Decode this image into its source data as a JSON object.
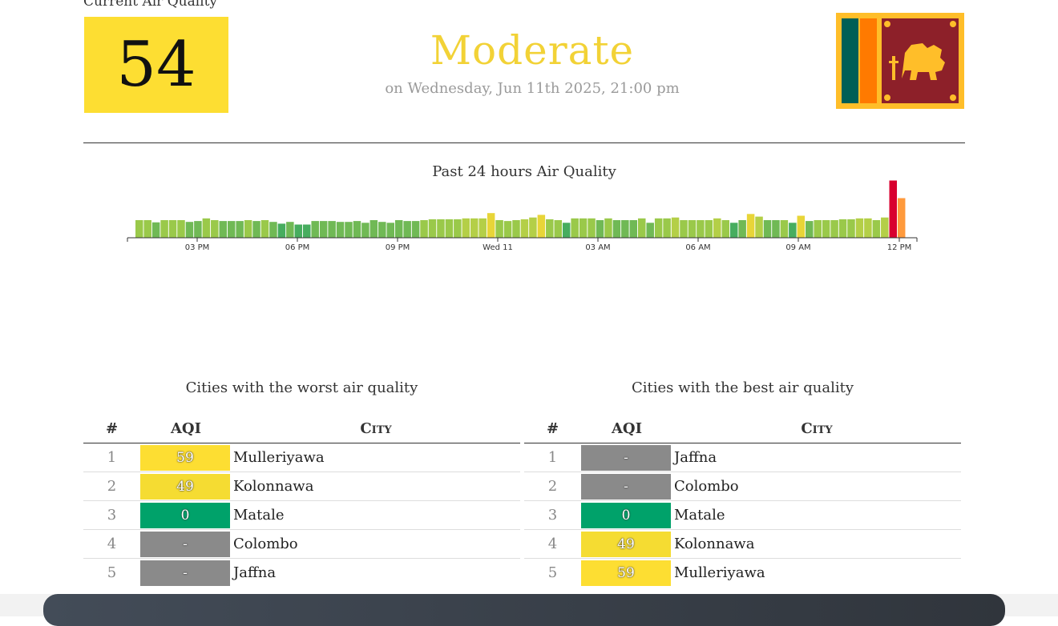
{
  "header": {
    "label": "Current Air Quality",
    "aqi_value": "54",
    "aqi_color": "#fdde32",
    "status": "Moderate",
    "status_color": "#f2d236",
    "date_text": "on Wednesday, Jun 11th 2025, 21:00 pm",
    "flag_icon": "sri-lanka-flag-icon"
  },
  "chart_data": {
    "type": "bar",
    "title": "Past 24 hours Air Quality",
    "tick_labels": [
      "03 PM",
      "06 PM",
      "09 PM",
      "Wed 11",
      "03 AM",
      "06 AM",
      "09 AM",
      "12 PM"
    ],
    "ylim": [
      0,
      120
    ],
    "values": [
      40,
      40,
      35,
      40,
      40,
      40,
      36,
      38,
      44,
      40,
      38,
      38,
      38,
      40,
      38,
      40,
      36,
      32,
      36,
      30,
      30,
      38,
      38,
      38,
      36,
      36,
      38,
      34,
      40,
      36,
      34,
      40,
      38,
      38,
      40,
      42,
      42,
      42,
      42,
      44,
      44,
      44,
      56,
      40,
      38,
      40,
      42,
      46,
      52,
      42,
      40,
      34,
      44,
      44,
      44,
      40,
      44,
      40,
      40,
      40,
      44,
      34,
      44,
      44,
      46,
      40,
      40,
      40,
      40,
      44,
      40,
      34,
      40,
      54,
      48,
      40,
      40,
      40,
      34,
      50,
      38,
      40,
      40,
      40,
      42,
      42,
      44,
      44,
      40,
      46,
      130,
      90
    ],
    "colors": [
      "#9ac94a",
      "#9ac94a",
      "#70b955",
      "#9ac94a",
      "#9ac94a",
      "#9ac94a",
      "#70b955",
      "#70b955",
      "#9ac94a",
      "#9ac94a",
      "#70b955",
      "#70b955",
      "#70b955",
      "#9ac94a",
      "#70b955",
      "#9ac94a",
      "#70b955",
      "#47ad5f",
      "#70b955",
      "#47ad5f",
      "#47ad5f",
      "#70b955",
      "#70b955",
      "#70b955",
      "#70b955",
      "#70b955",
      "#70b955",
      "#70b955",
      "#70b955",
      "#70b955",
      "#70b955",
      "#70b955",
      "#70b955",
      "#70b955",
      "#9ac94a",
      "#9ac94a",
      "#9ac94a",
      "#9ac94a",
      "#9ac94a",
      "#b4cf47",
      "#b4cf47",
      "#b4cf47",
      "#e8d538",
      "#9ac94a",
      "#9ac94a",
      "#9ac94a",
      "#b4cf47",
      "#b4cf47",
      "#e8d538",
      "#9ac94a",
      "#9ac94a",
      "#47ad5f",
      "#9ac94a",
      "#9ac94a",
      "#9ac94a",
      "#70b955",
      "#9ac94a",
      "#70b955",
      "#70b955",
      "#70b955",
      "#9ac94a",
      "#70b955",
      "#9ac94a",
      "#9ac94a",
      "#b4cf47",
      "#9ac94a",
      "#9ac94a",
      "#9ac94a",
      "#9ac94a",
      "#b4cf47",
      "#9ac94a",
      "#47ad5f",
      "#70b955",
      "#e8d538",
      "#b4cf47",
      "#70b955",
      "#70b955",
      "#9ac94a",
      "#47ad5f",
      "#e8d538",
      "#70b955",
      "#9ac94a",
      "#9ac94a",
      "#9ac94a",
      "#9ac94a",
      "#9ac94a",
      "#b4cf47",
      "#b4cf47",
      "#9ac94a",
      "#b4cf47",
      "#d8002f",
      "#ff9a3c"
    ]
  },
  "worst": {
    "title": "Cities with the worst air quality",
    "columns": [
      "#",
      "AQI",
      "City"
    ],
    "rows": [
      {
        "rank": "1",
        "aqi": "59",
        "city": "Mulleriyawa",
        "color": "#fdde32"
      },
      {
        "rank": "2",
        "aqi": "49",
        "city": "Kolonnawa",
        "color": "#f5dc32"
      },
      {
        "rank": "3",
        "aqi": "0",
        "city": "Matale",
        "color": "#00a26a"
      },
      {
        "rank": "4",
        "aqi": "-",
        "city": "Colombo",
        "color": "#8a8a8a"
      },
      {
        "rank": "5",
        "aqi": "-",
        "city": "Jaffna",
        "color": "#8a8a8a"
      }
    ]
  },
  "best": {
    "title": "Cities with the best air quality",
    "columns": [
      "#",
      "AQI",
      "City"
    ],
    "rows": [
      {
        "rank": "1",
        "aqi": "-",
        "city": "Jaffna",
        "color": "#8a8a8a"
      },
      {
        "rank": "2",
        "aqi": "-",
        "city": "Colombo",
        "color": "#8a8a8a"
      },
      {
        "rank": "3",
        "aqi": "0",
        "city": "Matale",
        "color": "#00a26a"
      },
      {
        "rank": "4",
        "aqi": "49",
        "city": "Kolonnawa",
        "color": "#f5dc32"
      },
      {
        "rank": "5",
        "aqi": "59",
        "city": "Mulleriyawa",
        "color": "#fdde32"
      }
    ]
  }
}
